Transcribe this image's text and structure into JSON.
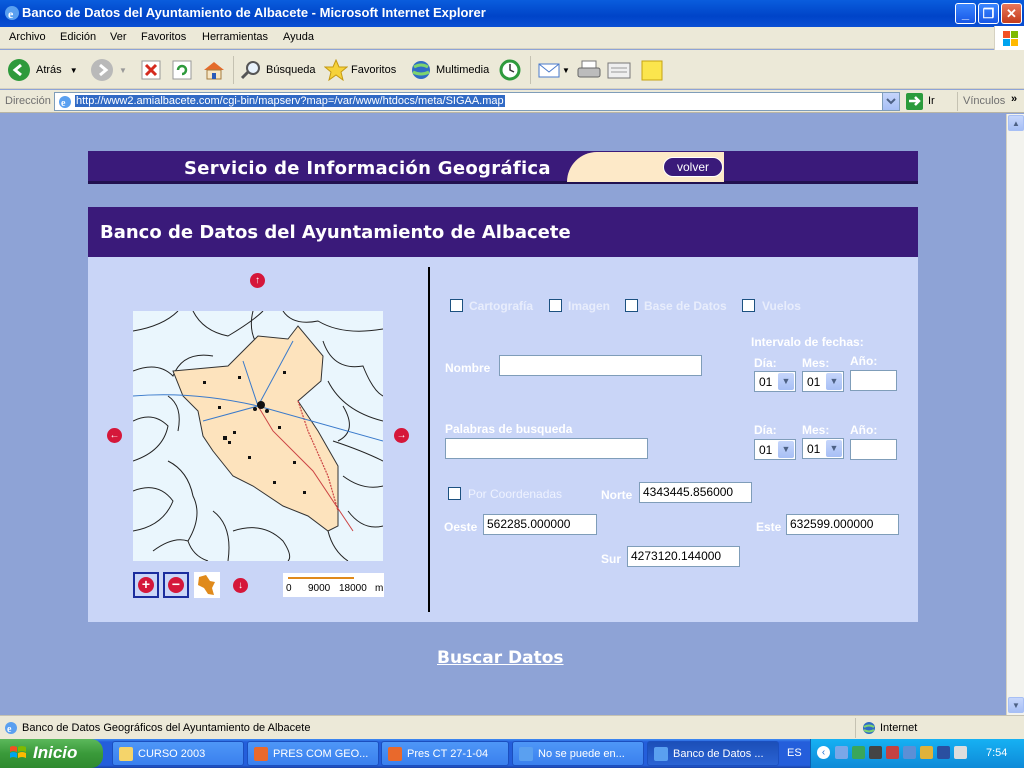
{
  "window": {
    "title": "Banco de Datos del Ayuntamiento de Albacete - Microsoft Internet Explorer",
    "min": "_",
    "max": "❐",
    "close": "✕"
  },
  "menu": [
    "Archivo",
    "Edición",
    "Ver",
    "Favoritos",
    "Herramientas",
    "Ayuda"
  ],
  "toolbar": {
    "back": "Atrás",
    "search": "Búsqueda",
    "favorites": "Favoritos",
    "multimedia": "Multimedia"
  },
  "address": {
    "label": "Dirección",
    "url": "http://www2.amialbacete.com/cgi-bin/mapserv?map=/var/www/htdocs/meta/SIGAA.map",
    "go": "Ir",
    "links": "Vínculos"
  },
  "page": {
    "banner_title": "Servicio de Información Geográfica",
    "volver": "volver",
    "panel_title": "Banco de Datos del Ayuntamiento de Albacete",
    "checkboxes": [
      "Cartografía",
      "Imagen",
      "Base de Datos",
      "Vuelos"
    ],
    "interval_label": "Intervalo de fechas:",
    "nombre_label": "Nombre",
    "nombre_value": "",
    "palabras_label": "Palabras de busqueda",
    "palabras_value": "",
    "dia_label": "Día:",
    "mes_label": "Mes:",
    "anio_label": "Año:",
    "date1": {
      "dia": "01",
      "mes": "01",
      "anio": ""
    },
    "date2": {
      "dia": "01",
      "mes": "01",
      "anio": ""
    },
    "coords_label": "Por Coordenadas",
    "norte_label": "Norte",
    "norte_value": "4343445.856000",
    "oeste_label": "Oeste",
    "oeste_value": "562285.000000",
    "este_label": "Este",
    "este_value": "632599.000000",
    "sur_label": "Sur",
    "sur_value": "4273120.144000",
    "scale_labels": [
      "0",
      "9000",
      "18000",
      "m"
    ],
    "buscar": "Buscar Datos",
    "zoom_in": "+",
    "zoom_out": "−",
    "arrow_up": "↑",
    "arrow_down": "↓",
    "arrow_left": "←",
    "arrow_right": "→"
  },
  "status": {
    "text": "Banco de Datos Geográficos del Ayuntamiento de Albacete",
    "zone": "Internet"
  },
  "taskbar": {
    "start": "Inicio",
    "tasks": [
      "CURSO 2003",
      "PRES COM GEO...",
      "Pres CT 27-1-04",
      "No se puede en...",
      "Banco de Datos ..."
    ],
    "lang": "ES",
    "clock": "7:54"
  },
  "colors": {
    "page_bg": "#8ea3d6",
    "panel_bg": "#c9d5f7",
    "header_purple": "#3a1a7a",
    "arrow_red": "#d5173a",
    "map_peach": "#fde3bd"
  }
}
